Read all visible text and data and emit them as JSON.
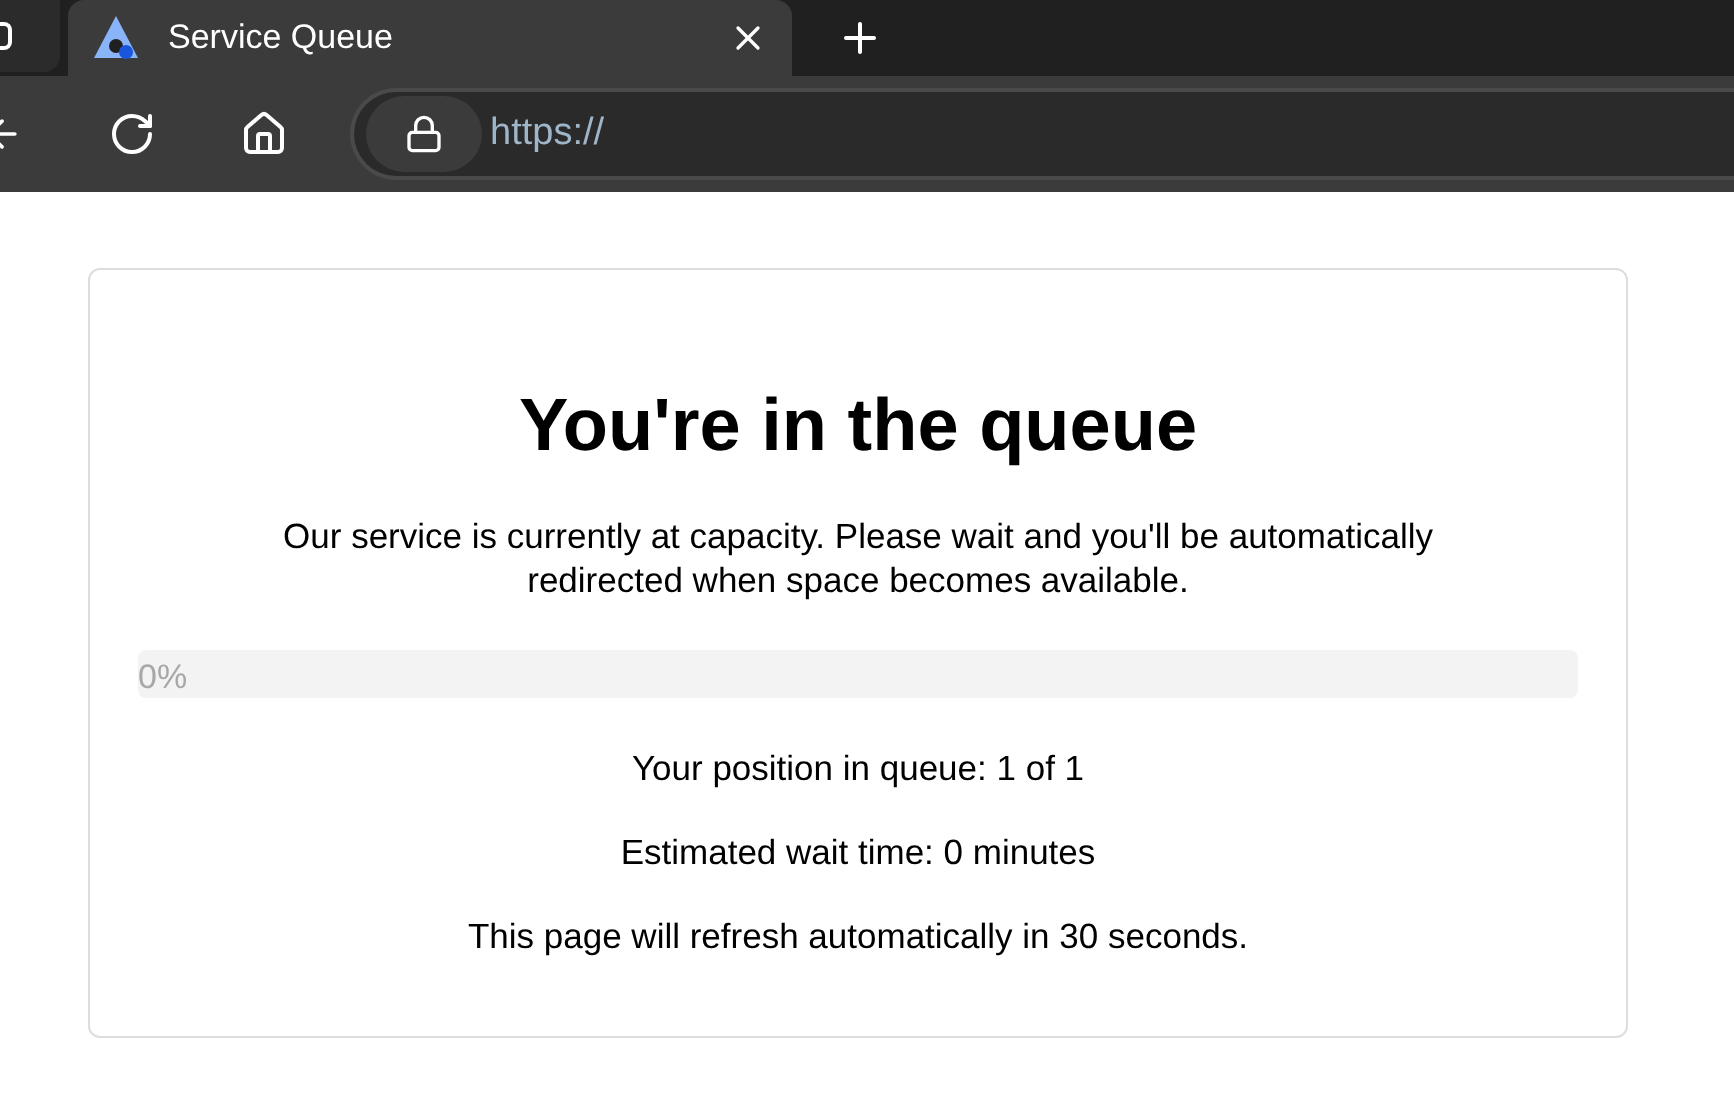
{
  "browser": {
    "tab_title": "Service Queue",
    "url": "https://"
  },
  "card": {
    "title": "You're in the queue",
    "message": "Our service is currently at capacity. Please wait and you'll be automatically redirected when space becomes available.",
    "progress": {
      "level": 0,
      "label": "0%"
    },
    "lines": [
      "Your position in queue: 1 of 1",
      "Estimated wait time: 0 minutes",
      "This page will refresh automatically in 30 seconds."
    ]
  }
}
